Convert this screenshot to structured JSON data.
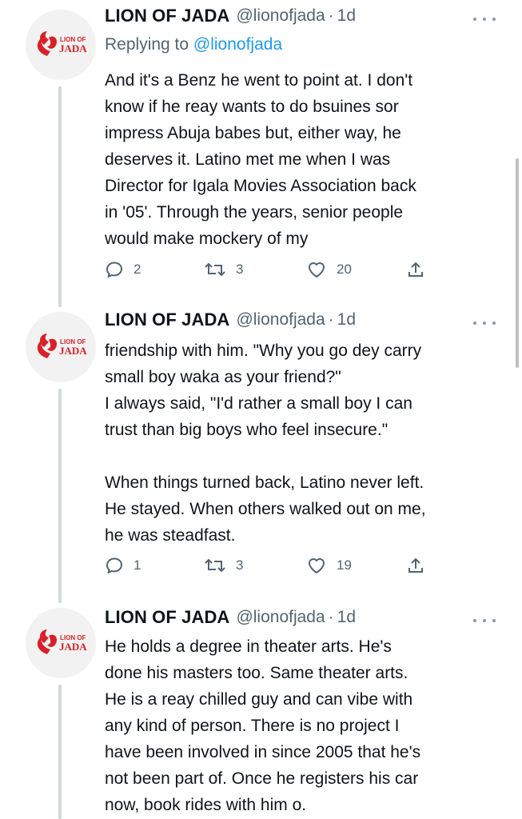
{
  "colors": {
    "text": "#0f1419",
    "secondary": "#536471",
    "link": "#1d9bf0",
    "thread": "#cfd9de",
    "logo_red": "#d92028"
  },
  "avatar": {
    "logo_text_line1": "LION OF",
    "logo_text_line2": "JADA"
  },
  "tweets": [
    {
      "name": "LION OF JADA",
      "handle": "@lionofjada",
      "dot": "·",
      "time": "1d",
      "replying_label": "Replying to ",
      "replying_handle": "@lionofjada",
      "lines": [
        "And it's a Benz he went to point at. I don't",
        "know if he reay wants to do bsuines sor",
        "impress Abuja babes but, either way, he",
        "deserves it. Latino met me when I was",
        "Director for Igala Movies Association back",
        "in '05'. Through the years, senior people",
        "would make mockery of my"
      ],
      "replies": "2",
      "retweets": "3",
      "likes": "20"
    },
    {
      "name": "LION OF JADA",
      "handle": "@lionofjada",
      "dot": "·",
      "time": "1d",
      "lines": [
        "friendship with him. \"Why you go dey carry",
        "small boy waka as your friend?\"",
        "I always said, \"I'd rather a small boy I can",
        "trust than big boys who feel insecure.\"",
        "",
        "When things turned back, Latino never left.",
        "He stayed. When others walked out on me,",
        "he was steadfast."
      ],
      "replies": "1",
      "retweets": "3",
      "likes": "19"
    },
    {
      "name": "LION OF JADA",
      "handle": "@lionofjada",
      "dot": "·",
      "time": "1d",
      "lines": [
        "He holds a degree in theater arts. He's",
        "done his masters too. Same theater arts.",
        "He is a reay chilled guy and can vibe with",
        "any kind of person. There is no project I",
        "have been involved in since 2005 that he's",
        "not been part of. Once he registers his car",
        "now, book rides with him o."
      ]
    }
  ]
}
